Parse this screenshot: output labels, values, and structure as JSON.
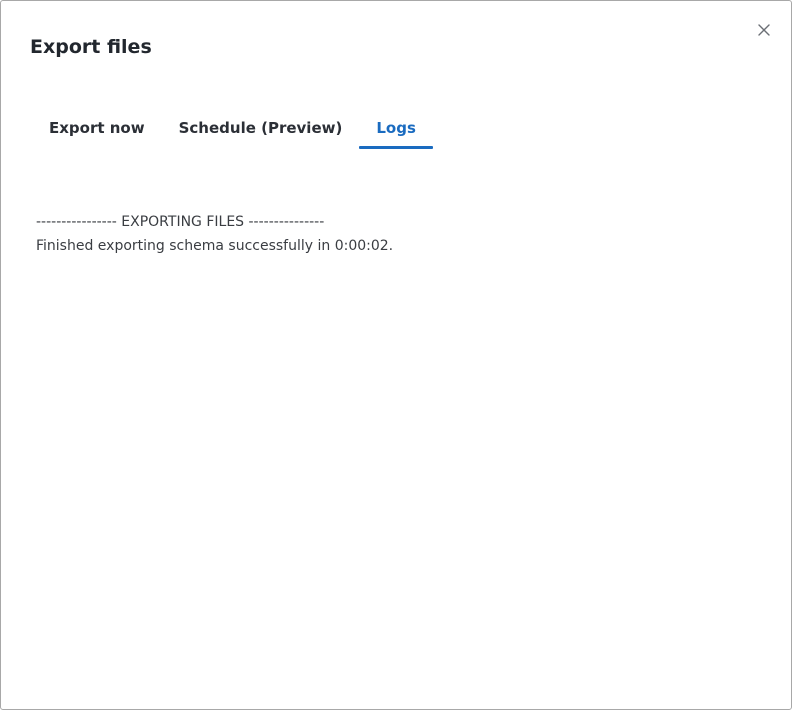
{
  "dialog": {
    "title": "Export files",
    "close_icon": "close-icon"
  },
  "tabs": [
    {
      "label": "Export now",
      "active": false
    },
    {
      "label": "Schedule (Preview)",
      "active": false
    },
    {
      "label": "Logs",
      "active": true
    }
  ],
  "logs": {
    "lines": [
      "---------------- EXPORTING FILES ---------------",
      "Finished exporting schema successfully in 0:00:02."
    ]
  },
  "colors": {
    "accent": "#1a6bc0",
    "text": "#2b2f36",
    "border": "#a8a8a8"
  }
}
